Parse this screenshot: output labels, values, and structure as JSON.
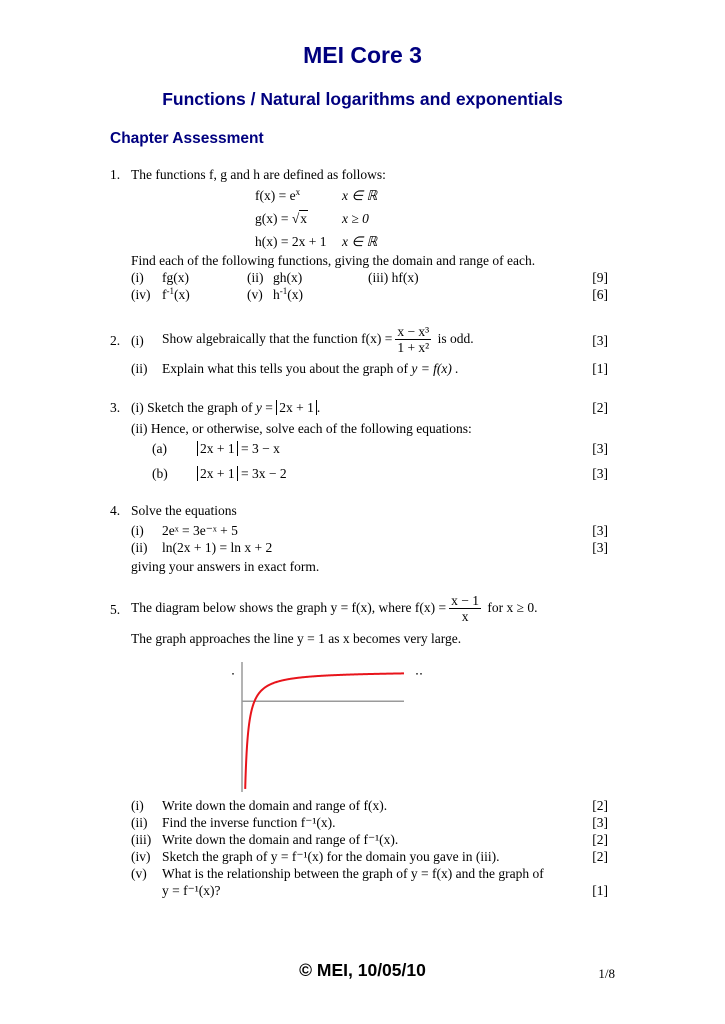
{
  "header": {
    "title": "MEI Core 3",
    "subtitle": "Functions / Natural logarithms and exponentials",
    "section": "Chapter Assessment"
  },
  "q1": {
    "num": "1.",
    "intro": "The functions f, g and h are defined as follows:",
    "defs": [
      {
        "lhs": "f(x) = e",
        "sup": "x",
        "domain": "x ∈ ℝ"
      },
      {
        "lhs": "g(x) = ",
        "sqrt": "x",
        "domain": "x ≥ 0"
      },
      {
        "lhs": "h(x) = 2x + 1",
        "domain": "x ∈ ℝ"
      }
    ],
    "instruction": "Find each of the following functions, giving the domain and range of each.",
    "parts_row1": [
      "(i)",
      "fg(x)",
      "(ii)",
      "gh(x)",
      "(iii) hf(x)"
    ],
    "parts_row2": [
      "(iv)",
      "f",
      "-1",
      "(x)",
      "(v)",
      "h",
      "-1",
      "(x)"
    ],
    "marks": [
      "[9]",
      "[6]"
    ]
  },
  "q2": {
    "num": "2.",
    "i_label": "(i)",
    "i_text": "Show algebraically that the function",
    "i_func_lhs": "f(x) =",
    "i_num": "x − x³",
    "i_den": "1 + x²",
    "i_tail": "is odd.",
    "i_mark": "[3]",
    "ii_label": "(ii)",
    "ii_text": "Explain what this tells you about the graph of",
    "ii_eq": "y = f(x) .",
    "ii_mark": "[1]"
  },
  "q3": {
    "num": "3.",
    "i_text": "(i) Sketch the graph of",
    "i_eq": "2x + 1",
    "i_mark": "[2]",
    "ii_text": "(ii) Hence, or otherwise, solve each of the following equations:",
    "a_label": "(a)",
    "a_abs": "2x + 1",
    "a_rhs": "= 3 − x",
    "a_mark": "[3]",
    "b_label": "(b)",
    "b_abs": "2x + 1",
    "b_rhs": "= 3x − 2",
    "b_mark": "[3]"
  },
  "q4": {
    "num": "4.",
    "intro": "Solve the equations",
    "i_label": "(i)",
    "i_eq": "2eˣ = 3e⁻ˣ + 5",
    "i_mark": "[3]",
    "ii_label": "(ii)",
    "ii_eq": "ln(2x + 1) = ln x + 2",
    "ii_mark": "[3]",
    "outro": "giving your answers in exact form."
  },
  "q5": {
    "num": "5.",
    "intro": "The diagram below shows the graph y = f(x), where",
    "func_lhs": "f(x) =",
    "num_expr": "x − 1",
    "den_expr": "x",
    "tail": "for x ≥ 0.",
    "line2": "The graph approaches the line y = 1 as x becomes very large.",
    "parts": [
      {
        "label": "(i)",
        "text": "Write down the domain and range of f(x).",
        "mark": "[2]"
      },
      {
        "label": "(ii)",
        "text": "Find the inverse function f⁻¹(x).",
        "mark": "[3]"
      },
      {
        "label": "(iii)",
        "text": "Write down the domain and range of f⁻¹(x).",
        "mark": "[2]"
      },
      {
        "label": "(iv)",
        "text": "Sketch the graph of y = f⁻¹(x) for the domain you gave in (iii).",
        "mark": "[2]"
      },
      {
        "label": "(v)",
        "text": "What is the relationship between the graph of y = f(x) and the graph of",
        "mark": ""
      },
      {
        "label": "",
        "text": "y = f⁻¹(x)?",
        "mark": "[1]"
      }
    ],
    "graph": {
      "function": "(x-1)/x",
      "asymptote_y": 1,
      "x_domain": [
        0,
        13
      ],
      "y_range": [
        -3,
        1.3
      ],
      "curve_color": "#e8141b",
      "axis_color": "#9a9a9a"
    }
  },
  "footer": {
    "copyright": "© MEI, 10/05/10",
    "page": "1/8"
  }
}
